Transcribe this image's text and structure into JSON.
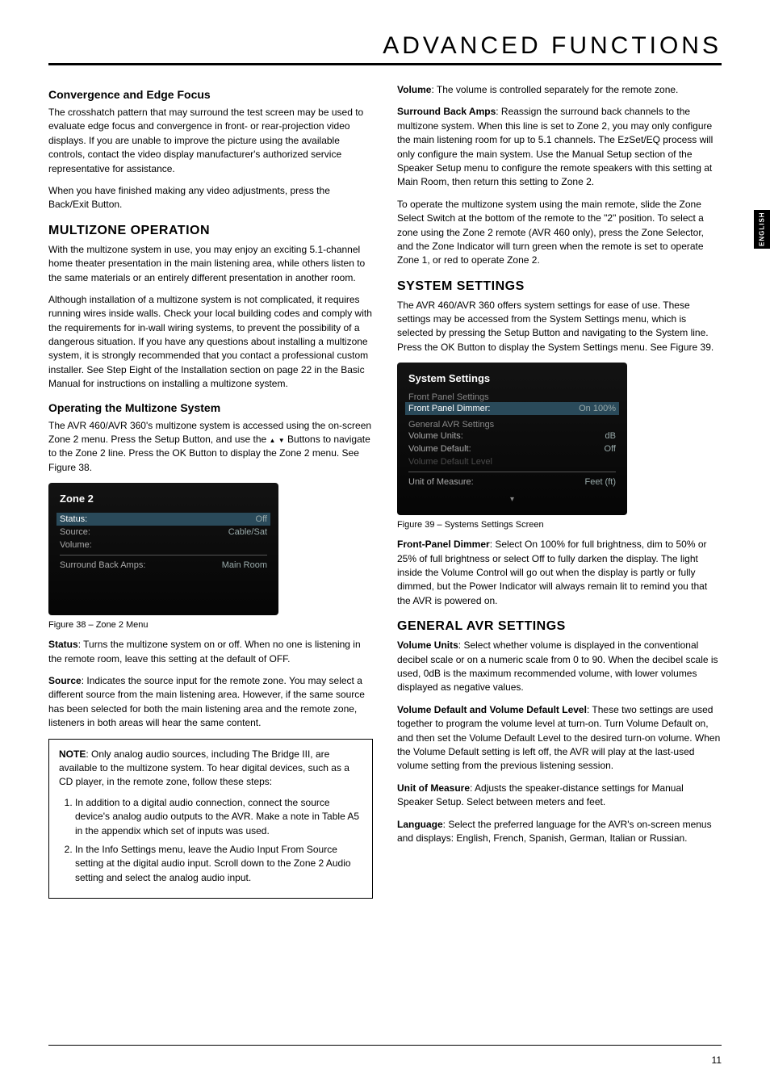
{
  "header": {
    "title": "ADVANCED FUNCTIONS"
  },
  "sideTab": "ENGLISH",
  "pageNumber": "11",
  "left": {
    "h1": "Convergence and Edge Focus",
    "p1": "The crosshatch pattern that may surround the test screen may be used to evaluate edge focus and convergence in front- or rear-projection video displays. If you are unable to improve the picture using the available controls, contact the video display manufacturer's authorized service representative for assistance.",
    "p2": "When you have finished making any video adjustments, press the Back/Exit Button.",
    "h2": "MULTIZONE OPERATION",
    "p3": "With the multizone system in use, you may enjoy an exciting 5.1-channel home theater presentation in the main listening area, while others listen to the same materials or an entirely different presentation in another room.",
    "p4": "Although installation of a multizone system is not complicated, it requires running wires inside walls. Check your local building codes and comply with the requirements for in-wall wiring systems, to prevent the possibility of a dangerous situation. If you have any questions about installing a multizone system, it is strongly recommended that you contact a professional custom installer. See Step Eight of the Installation section on page 22 in the Basic Manual for instructions on installing a multizone system.",
    "h3": "Operating the Multizone System",
    "p5a": "The AVR 460/AVR 360's multizone system is accessed using the on-screen Zone 2 menu. Press the Setup Button, and use the ",
    "p5b": " Buttons to navigate to the Zone 2 line. Press the OK Button to display the Zone 2 menu. See Figure 38.",
    "fig38": {
      "title": "Zone 2",
      "rows": [
        {
          "label": "Status:",
          "value": "Off",
          "sel": true
        },
        {
          "label": "Source:",
          "value": "Cable/Sat"
        },
        {
          "label": "Volume:",
          "value": ""
        },
        {
          "label": "Surround Back Amps:",
          "value": "Main Room"
        }
      ]
    },
    "cap38": "Figure 38 – Zone 2 Menu",
    "p6lead": "Status",
    "p6": ": Turns the multizone system on or off. When no one is listening in the remote room, leave this setting at the default of OFF.",
    "p7lead": "Source",
    "p7": ": Indicates the source input for the remote zone. You may select a different source from the main listening area. However, if the same source has been selected for both the main listening area and the remote zone, listeners in both areas will hear the same content.",
    "note": {
      "lead": "NOTE",
      "intro": ": Only analog audio sources, including The Bridge III, are available to the multizone system. To hear digital devices, such as a CD player, in the remote zone, follow these steps:",
      "li1": "In addition to a digital audio connection, connect the source device's analog audio outputs to the AVR. Make a note in Table A5 in the appendix which set of inputs was used.",
      "li2": "In the Info Settings menu, leave the Audio Input From Source setting at the digital audio input. Scroll down to the Zone 2 Audio setting and select the analog audio input."
    }
  },
  "right": {
    "p1lead": "Volume",
    "p1": ": The volume is controlled separately for the remote zone.",
    "p2lead": "Surround Back Amps",
    "p2": ": Reassign the surround back channels to the multizone system. When this line is set to Zone 2, you may only configure the main listening room for up to 5.1 channels. The EzSet/EQ process will only configure the main system. Use the Manual Setup section of the Speaker Setup menu to configure the remote speakers with this setting at Main Room, then return this setting to Zone 2.",
    "p3": "To operate the multizone system using the main remote, slide the Zone Select Switch at the bottom of the remote to the \"2\" position. To select a zone using the Zone 2 remote (AVR 460 only), press the Zone Selector, and the Zone Indicator will turn green when the remote is set to operate Zone 1, or red to operate Zone 2.",
    "h1": "SYSTEM SETTINGS",
    "p4": "The AVR 460/AVR 360 offers system settings for ease of use. These settings may be accessed from the System Settings menu, which is selected by pressing the Setup Button and navigating to the System line. Press the OK Button to display the System Settings menu. See Figure 39.",
    "fig39": {
      "title": "System Settings",
      "group1": "Front Panel Settings",
      "row1": {
        "label": "Front Panel Dimmer:",
        "value": "On 100%"
      },
      "group2": "General AVR Settings",
      "rows2": [
        {
          "label": "Volume Units:",
          "value": "dB"
        },
        {
          "label": "Volume Default:",
          "value": "Off"
        },
        {
          "label": "Volume Default Level",
          "value": ""
        }
      ],
      "row3": {
        "label": "Unit of Measure:",
        "value": "Feet (ft)"
      }
    },
    "cap39": "Figure 39 – Systems Settings Screen",
    "p5lead": "Front-Panel Dimmer",
    "p5": ": Select On 100% for full brightness, dim to 50% or 25% of full brightness or select Off to fully darken the display. The light inside the Volume Control will go out when the display is partly or fully dimmed, but the Power Indicator will always remain lit to remind you that the AVR is powered on.",
    "h2": "GENERAL AVR SETTINGS",
    "p6lead": "Volume Units",
    "p6": ": Select whether volume is displayed in the conventional decibel scale or on a numeric scale from 0 to 90. When the decibel scale is used, 0dB is the maximum recommended volume, with lower volumes displayed as negative values.",
    "p7lead": "Volume Default and Volume Default Level",
    "p7": ": These two settings are used together to program the volume level at turn-on. Turn Volume Default on, and then set the Volume Default Level to the desired turn-on volume. When the Volume Default setting is left off, the AVR will play at the last-used volume setting from the previous listening session.",
    "p8lead": "Unit of Measure",
    "p8": ": Adjusts the speaker-distance settings for Manual Speaker Setup. Select between meters and feet.",
    "p9lead": "Language",
    "p9": ": Select the preferred language for the AVR's on-screen menus and displays: English, French, Spanish, German, Italian or Russian."
  }
}
